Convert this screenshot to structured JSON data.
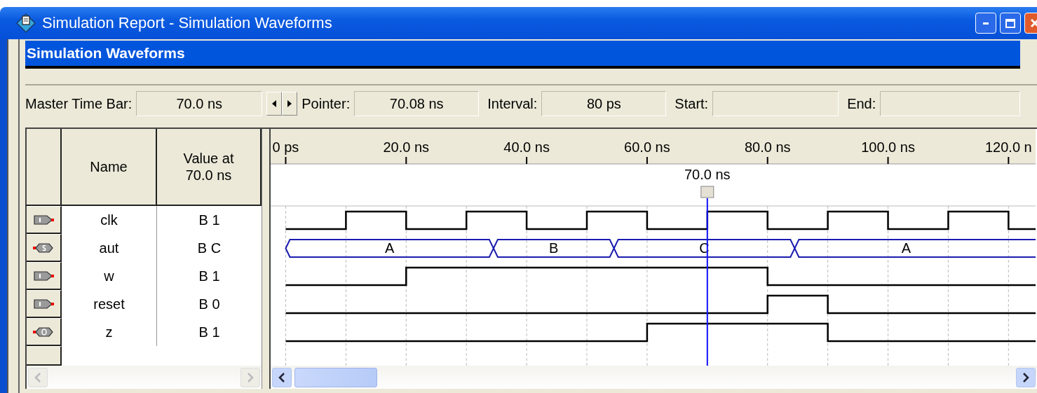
{
  "window": {
    "title": "Simulation Report - Simulation Waveforms"
  },
  "panel": {
    "title": "Simulation Waveforms"
  },
  "toolbar": {
    "master_time_bar": {
      "label": "Master Time Bar:",
      "value": "70.0 ns"
    },
    "pointer": {
      "label": "Pointer:",
      "value": "70.08 ns"
    },
    "interval": {
      "label": "Interval:",
      "value": "80 ps"
    },
    "start": {
      "label": "Start:"
    },
    "end": {
      "label": "End:"
    }
  },
  "table": {
    "columns": [
      "Name",
      "Value at 70.0 ns"
    ],
    "rows": [
      {
        "kind": "input",
        "name": "clk",
        "value": "B 1"
      },
      {
        "kind": "bus",
        "name": "aut",
        "value": "B C",
        "bus_labels": [
          "A",
          "B",
          "C",
          "A"
        ]
      },
      {
        "kind": "input",
        "name": "w",
        "value": "B 1"
      },
      {
        "kind": "input",
        "name": "reset",
        "value": "B 0"
      },
      {
        "kind": "output",
        "name": "z",
        "value": "B 1"
      }
    ]
  },
  "waveform": {
    "time_labels": [
      "0 ps",
      "20.0 ns",
      "40.0 ns",
      "60.0 ns",
      "80.0 ns",
      "100.0 ns",
      "120.0 n"
    ],
    "cursor_label": "70.0 ns"
  }
}
